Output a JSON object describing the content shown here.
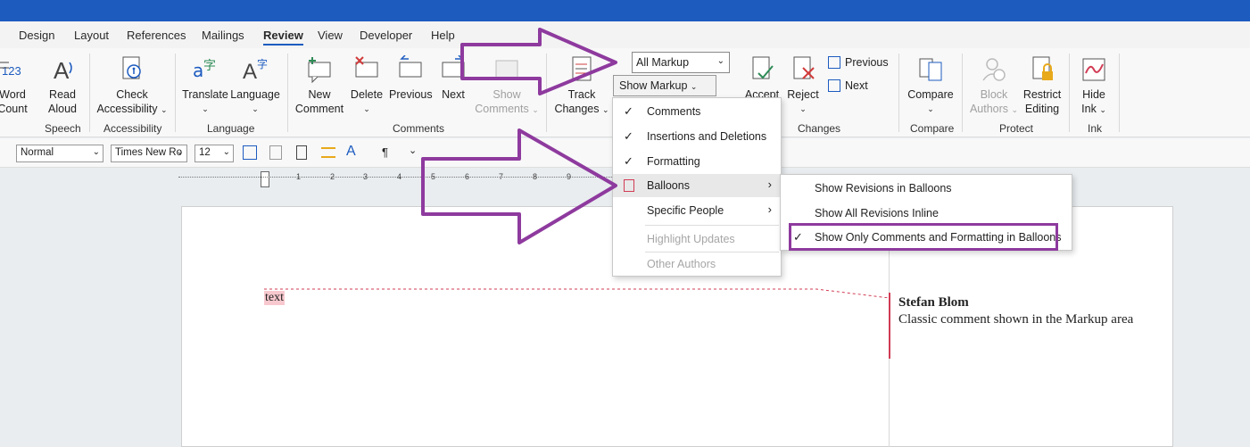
{
  "menubar": {
    "tabs": [
      "Design",
      "Layout",
      "References",
      "Mailings",
      "Review",
      "View",
      "Developer",
      "Help"
    ],
    "active_tab": "Review"
  },
  "ribbon": {
    "word_count": {
      "line1": "Word",
      "line2": "Count"
    },
    "read_aloud": {
      "line1": "Read",
      "line2": "Aloud"
    },
    "check_accessibility": {
      "line1": "Check",
      "line2": "Accessibility"
    },
    "translate": "Translate",
    "language": "Language",
    "new_comment": {
      "line1": "New",
      "line2": "Comment"
    },
    "delete": "Delete",
    "previous": "Previous",
    "next": "Next",
    "show_comments": {
      "line1": "Show",
      "line2": "Comments"
    },
    "track_changes": {
      "line1": "Track",
      "line2": "Changes"
    },
    "all_markup": "All Markup",
    "show_markup": "Show Markup",
    "accept": "Accept",
    "reject": "Reject",
    "changes_previous": "Previous",
    "changes_next": "Next",
    "compare": "Compare",
    "block_authors": {
      "line1": "Block",
      "line2": "Authors"
    },
    "restrict_editing": {
      "line1": "Restrict",
      "line2": "Editing"
    },
    "hide_ink": {
      "line1": "Hide",
      "line2": "Ink"
    },
    "groups": {
      "speech": "Speech",
      "accessibility": "Accessibility",
      "language": "Language",
      "comments": "Comments",
      "changes": "Changes",
      "compare": "Compare",
      "protect": "Protect",
      "ink": "Ink"
    }
  },
  "formatbar": {
    "style": "Normal",
    "font": "Times New Ro",
    "size": "12"
  },
  "ruler": {
    "ticks": [
      "1",
      "2",
      "3",
      "4",
      "5",
      "6",
      "7",
      "8",
      "9"
    ]
  },
  "show_markup_menu": {
    "items": [
      {
        "label": "Comments",
        "checked": true,
        "disabled": false
      },
      {
        "label": "Insertions and Deletions",
        "checked": true,
        "disabled": false
      },
      {
        "label": "Formatting",
        "checked": true,
        "disabled": false
      },
      {
        "label": "Balloons",
        "checked": false,
        "disabled": false
      },
      {
        "label": "Specific People",
        "checked": false,
        "disabled": false
      },
      {
        "label": "Highlight Updates",
        "checked": false,
        "disabled": true
      },
      {
        "label": "Other Authors",
        "checked": false,
        "disabled": true
      }
    ]
  },
  "balloons_submenu": {
    "items": [
      {
        "label": "Show Revisions in Balloons",
        "checked": false
      },
      {
        "label": "Show All Revisions Inline",
        "checked": false
      },
      {
        "label": "Show Only Comments and Formatting in Balloons",
        "checked": true
      }
    ]
  },
  "document": {
    "text": "text",
    "comment_author": "Stefan Blom",
    "comment_body": "Classic comment shown in the Markup area"
  },
  "colors": {
    "title_bar": "#1d5bbf",
    "annotation_purple": "#8e3a9e",
    "comment_accent": "#d13c55",
    "insert_highlight": "#f7c9cf"
  }
}
